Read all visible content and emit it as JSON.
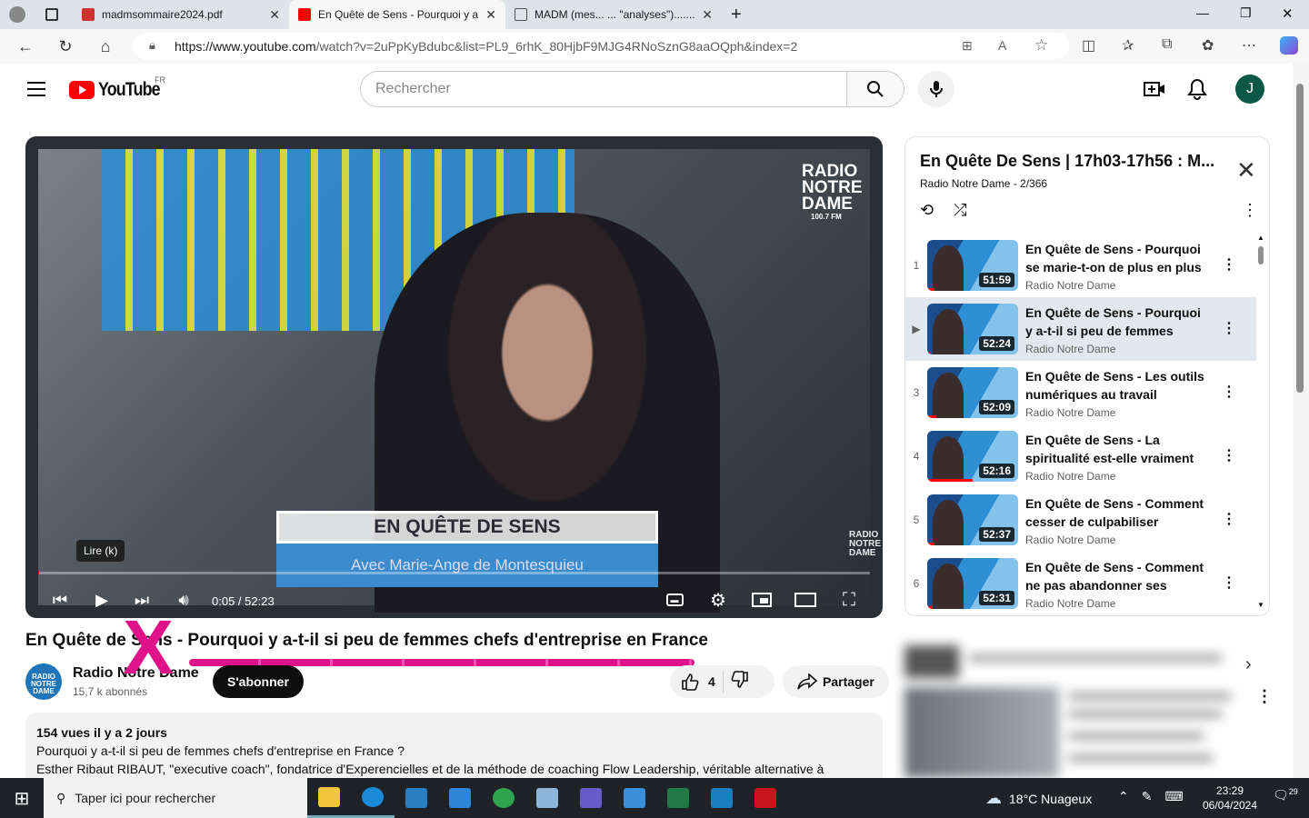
{
  "browser": {
    "tabs": [
      {
        "label": "madmsommaire2024.pdf",
        "fav_color": "#d0312d"
      },
      {
        "label": "En Quête de Sens - Pourquoi y a",
        "fav_color": "#ff0000"
      },
      {
        "label": "MADM (mes... ... \"analyses\")........",
        "fav_color": "#777777"
      }
    ],
    "new_tab": "+",
    "url_host": "https://www.youtube.com",
    "url_path": "/watch?v=2uPpKyBdubc&list=PL9_6rhK_80HjbF9MJG4RNoSznG8aaOQph&index=2"
  },
  "youtube": {
    "logo_text": "YouTube",
    "logo_country": "FR",
    "search_placeholder": "Rechercher",
    "avatar_letter": "J",
    "player": {
      "brand_line1": "RADIO",
      "brand_line2": "NOTRE",
      "brand_line3": "DAME",
      "brand_freq": "100.7 FM",
      "corner_brand": "RADIO NOTRE DAME",
      "lower_third_title": "EN QUÊTE DE SENS",
      "lower_third_sub": "Avec Marie-Ange de Montesquieu",
      "tooltip": "Lire (k)",
      "time": "0:05 / 52:23",
      "progress": 0.0016
    },
    "video": {
      "title": "En Quête de Sens - Pourquoi y a-t-il si peu de femmes chefs d'entreprise en France",
      "channel": "Radio Notre Dame",
      "channel_avatar": "RADIO NOTRE DAME",
      "subscribers": "15,7 k abonnés",
      "subscribe_label": "S'abonner",
      "likes": "4",
      "share_label": "Partager",
      "views": "154 vues  il y a 2 jours",
      "desc_line1": "Pourquoi y a-t-il si peu de femmes chefs d'entreprise en France ?",
      "desc_line2": "Esther Ribaut RIBAUT, \"executive coach\", fondatrice d'Experencielles et de la méthode de coaching Flow Leadership, véritable alternative à"
    },
    "annotation_mark": "X",
    "playlist": {
      "title": "En Quête De Sens | 17h03-17h56 : M...",
      "subtitle": "Radio Notre Dame - 2/366",
      "items": [
        {
          "index": "1",
          "title": "En Quête de Sens - Pourquoi se marie-t-on de plus en plus tar...",
          "channel": "Radio Notre Dame",
          "duration": "51:59",
          "watched": 0.08
        },
        {
          "index": "▶",
          "title": "En Quête de Sens - Pourquoi y a-t-il si peu de femmes chefs...",
          "channel": "Radio Notre Dame",
          "duration": "52:24",
          "watched": 0.03
        },
        {
          "index": "3",
          "title": "En Quête de Sens - Les outils numériques au travail risquen...",
          "channel": "Radio Notre Dame",
          "duration": "52:09",
          "watched": 0.1
        },
        {
          "index": "4",
          "title": "En Quête de Sens - La spiritualité est-elle vraiment à...",
          "channel": "Radio Notre Dame",
          "duration": "52:16",
          "watched": 0.5
        },
        {
          "index": "5",
          "title": "En Quête de Sens - Comment cesser de culpabiliser quand...",
          "channel": "Radio Notre Dame",
          "duration": "52:37",
          "watched": 0.08
        },
        {
          "index": "6",
          "title": "En Quête de Sens - Comment ne pas abandonner ses effort...",
          "channel": "Radio Notre Dame",
          "duration": "52:31",
          "watched": 0.05
        }
      ]
    }
  },
  "taskbar": {
    "search_placeholder": "Taper ici pour rechercher",
    "weather": "18°C  Nuageux",
    "time": "23:29",
    "date": "06/04/2024",
    "notifications": "29",
    "apps": [
      {
        "name": "file-explorer",
        "color": "#f2c53d"
      },
      {
        "name": "edge",
        "color": "#1b8ad6"
      },
      {
        "name": "app-blue",
        "color": "#2a7fc2"
      },
      {
        "name": "mail",
        "color": "#2f86d8"
      },
      {
        "name": "chrome",
        "color": "#2ea44f"
      },
      {
        "name": "notes",
        "color": "#8fb5d8"
      },
      {
        "name": "app-purple",
        "color": "#6a5ac8"
      },
      {
        "name": "store",
        "color": "#3b8ed8"
      },
      {
        "name": "excel",
        "color": "#1f7a45"
      },
      {
        "name": "app-teal",
        "color": "#1b7fbf"
      },
      {
        "name": "filezilla",
        "color": "#c8161d"
      }
    ]
  }
}
